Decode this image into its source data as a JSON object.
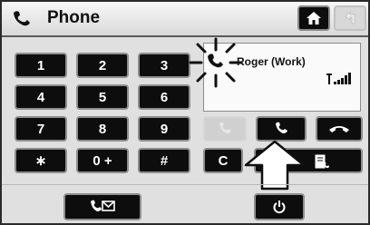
{
  "header": {
    "title": "Phone",
    "icon": "phone-handset-icon"
  },
  "keypad": [
    {
      "label": "1"
    },
    {
      "label": "2"
    },
    {
      "label": "3"
    },
    {
      "label": "4"
    },
    {
      "label": "5"
    },
    {
      "label": "6"
    },
    {
      "label": "7"
    },
    {
      "label": "8"
    },
    {
      "label": "9"
    },
    {
      "label": "∗"
    },
    {
      "label": "0 +"
    },
    {
      "label": "#"
    }
  ],
  "call_info": {
    "contact": "Roger (Work)",
    "signal_icon": "signal-strength-icon"
  },
  "clear_label": "C",
  "icons": {
    "home": "home-icon",
    "back": "back-arrow-icon",
    "pickup_disabled": "pickup-icon",
    "pickup": "pickup-icon",
    "hangup": "hangup-icon",
    "contacts": "contacts-icon",
    "voicemail": "voicemail-icon",
    "power": "power-icon",
    "ringing": "ringing-burst-icon",
    "arrow": "up-arrow-icon"
  },
  "colors": {
    "button": "#0d0d0d",
    "screen": "#e0e0e0",
    "display": "#fafafa"
  }
}
